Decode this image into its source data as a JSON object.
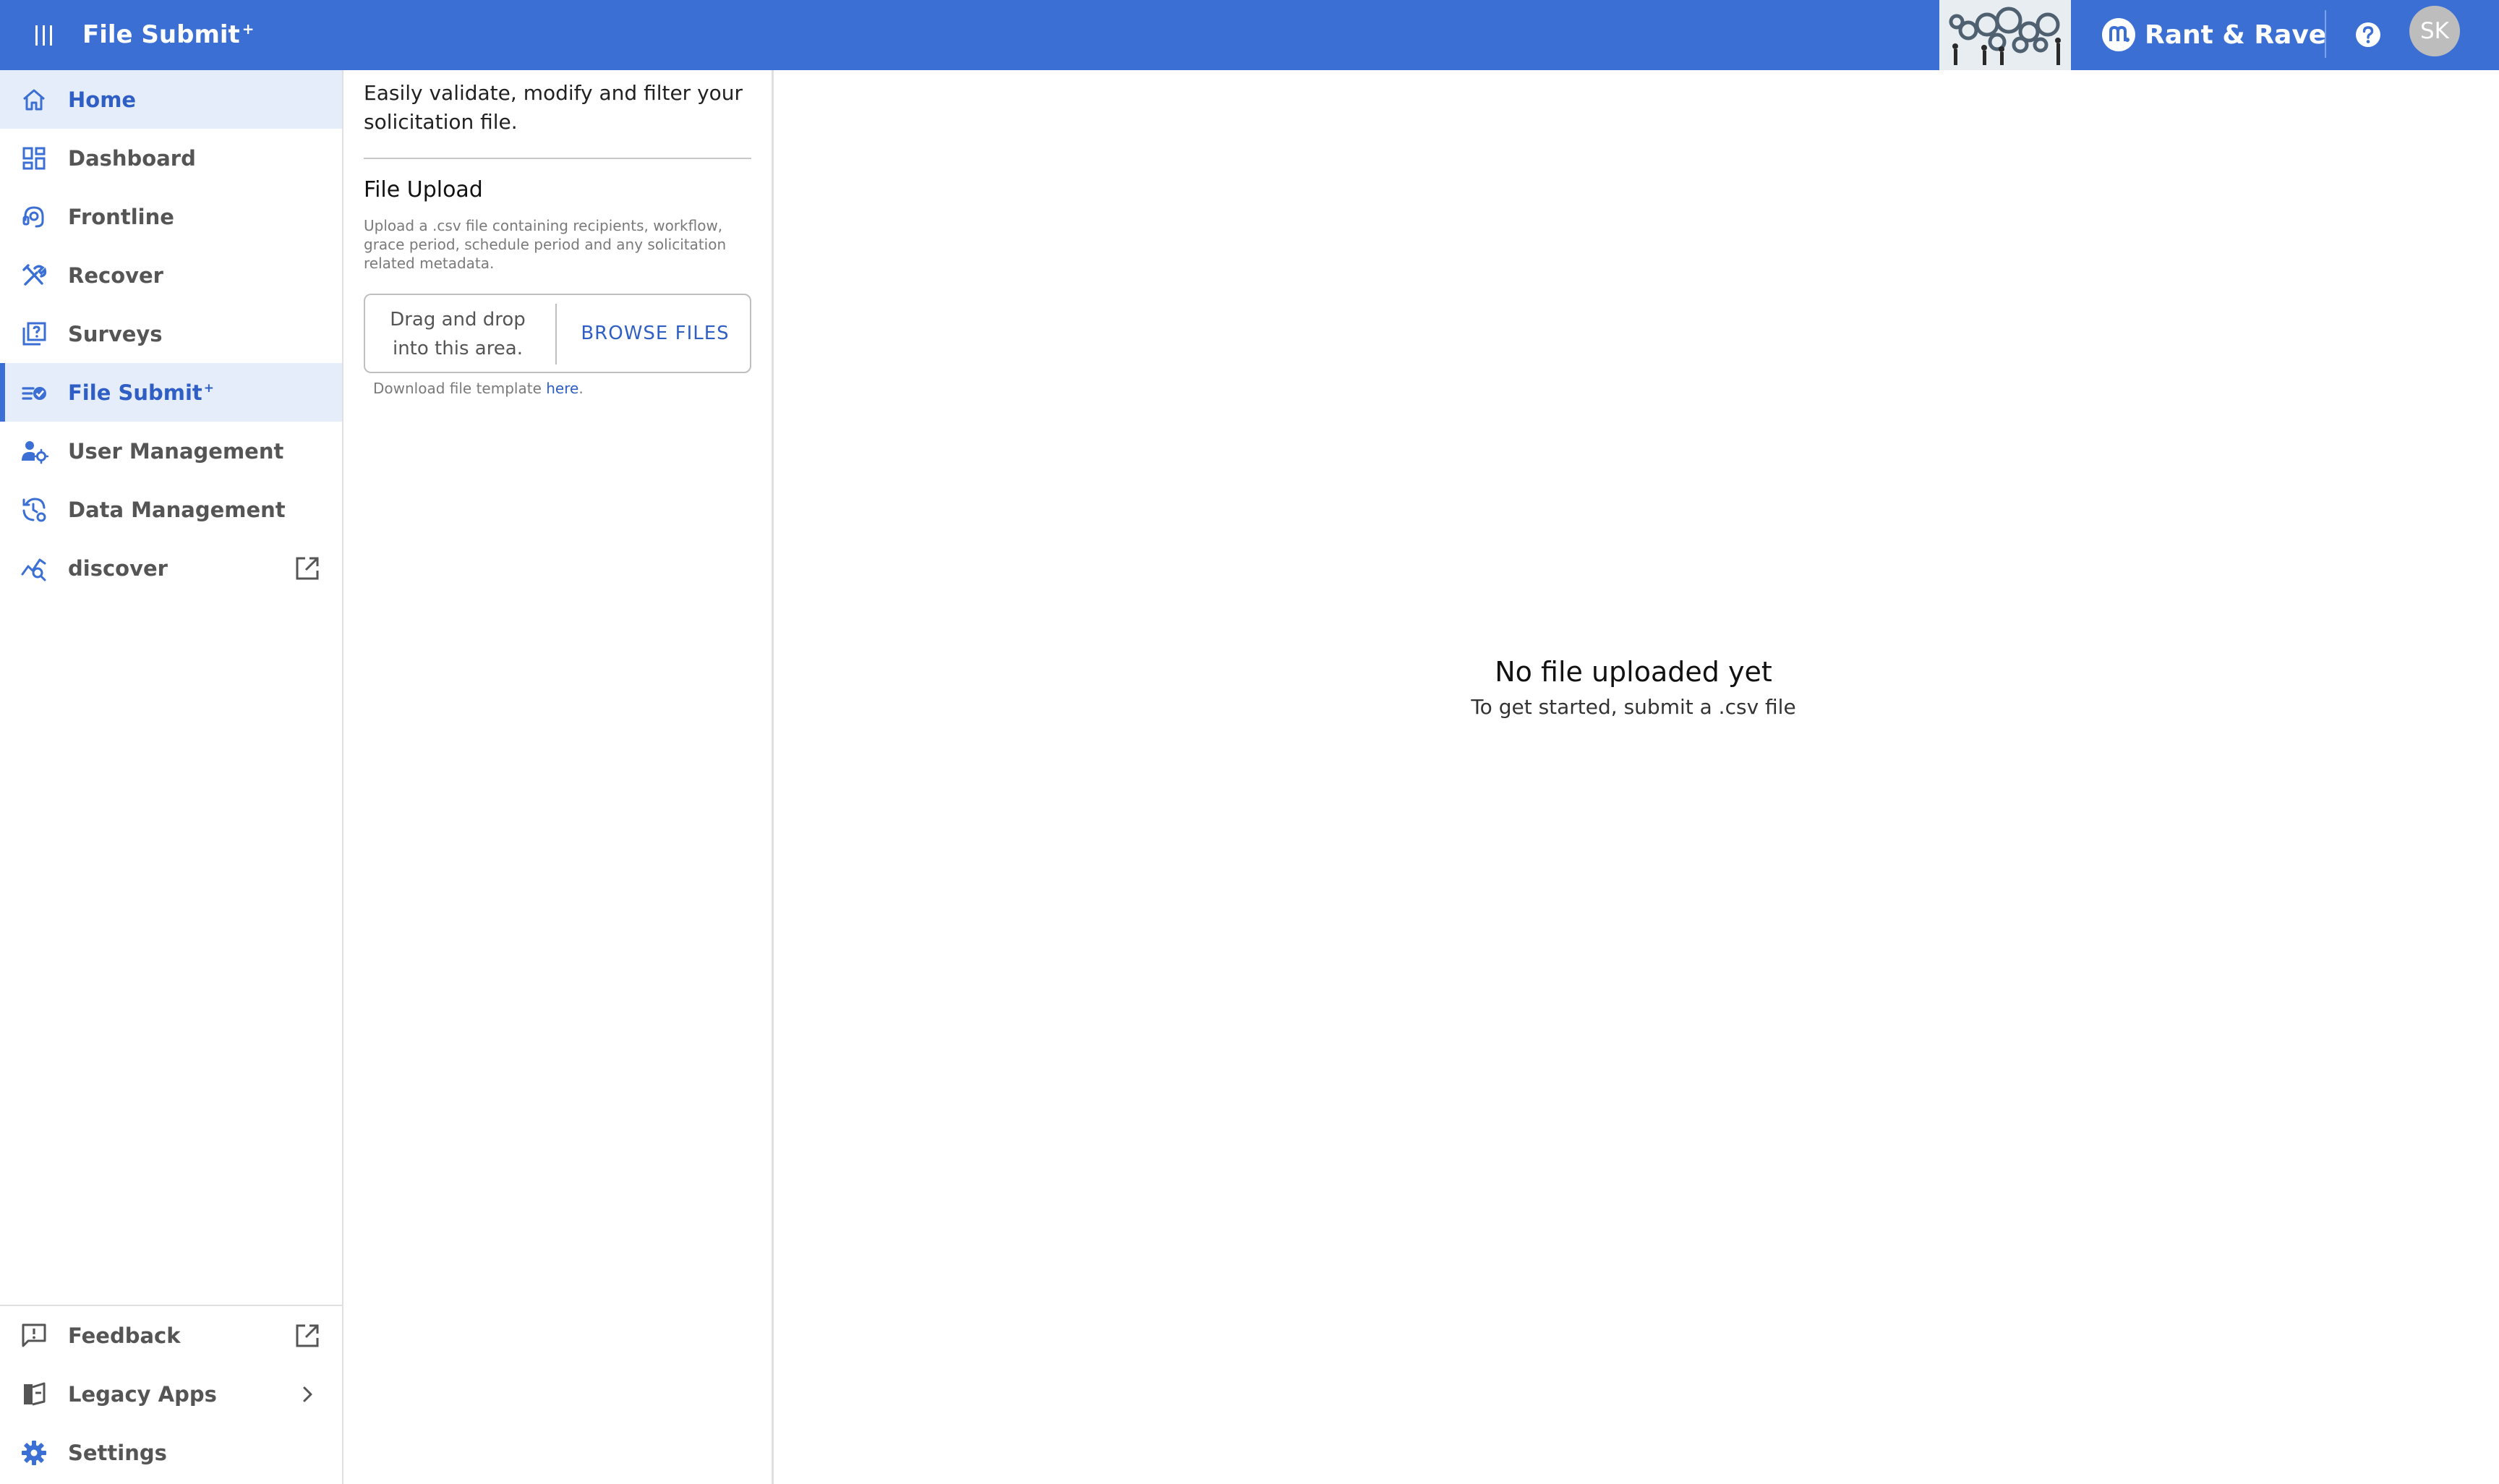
{
  "header": {
    "title": "File Submit",
    "title_sup": "+",
    "brand": "Rant & Rave",
    "avatar_initials": "SK",
    "colors": {
      "bar": "#3b6fd4",
      "accent": "#2f5fc4"
    }
  },
  "sidebar": {
    "items": [
      {
        "label": "Home",
        "icon": "home-icon"
      },
      {
        "label": "Dashboard",
        "icon": "dashboard-icon"
      },
      {
        "label": "Frontline",
        "icon": "headset-icon"
      },
      {
        "label": "Recover",
        "icon": "tools-icon"
      },
      {
        "label": "Surveys",
        "icon": "survey-icon"
      },
      {
        "label": "File Submit",
        "sup": "+",
        "icon": "file-submit-icon",
        "selected": true
      },
      {
        "label": "User Management",
        "icon": "user-settings-icon"
      },
      {
        "label": "Data Management",
        "icon": "data-history-icon"
      },
      {
        "label": "discover",
        "icon": "analytics-icon",
        "trailing_icon": "external-link-icon"
      }
    ],
    "footer": [
      {
        "label": "Feedback",
        "icon": "feedback-icon",
        "trailing_icon": "external-link-icon"
      },
      {
        "label": "Legacy Apps",
        "icon": "legacy-apps-icon",
        "trailing_icon": "chevron-right-icon"
      },
      {
        "label": "Settings",
        "icon": "gear-icon"
      }
    ]
  },
  "upload_panel": {
    "intro": "Easily validate, modify and filter your solicitation file.",
    "title": "File Upload",
    "description": "Upload a .csv file containing recipients, workflow, grace period, schedule period and any solicitation related metadata.",
    "drop_text": "Drag and drop into this area.",
    "browse_label": "BROWSE FILES",
    "template_prefix": "Download file template ",
    "template_link": "here",
    "template_suffix": "."
  },
  "main": {
    "empty_title": "No file uploaded yet",
    "empty_subtitle": "To get started, submit a .csv file"
  }
}
